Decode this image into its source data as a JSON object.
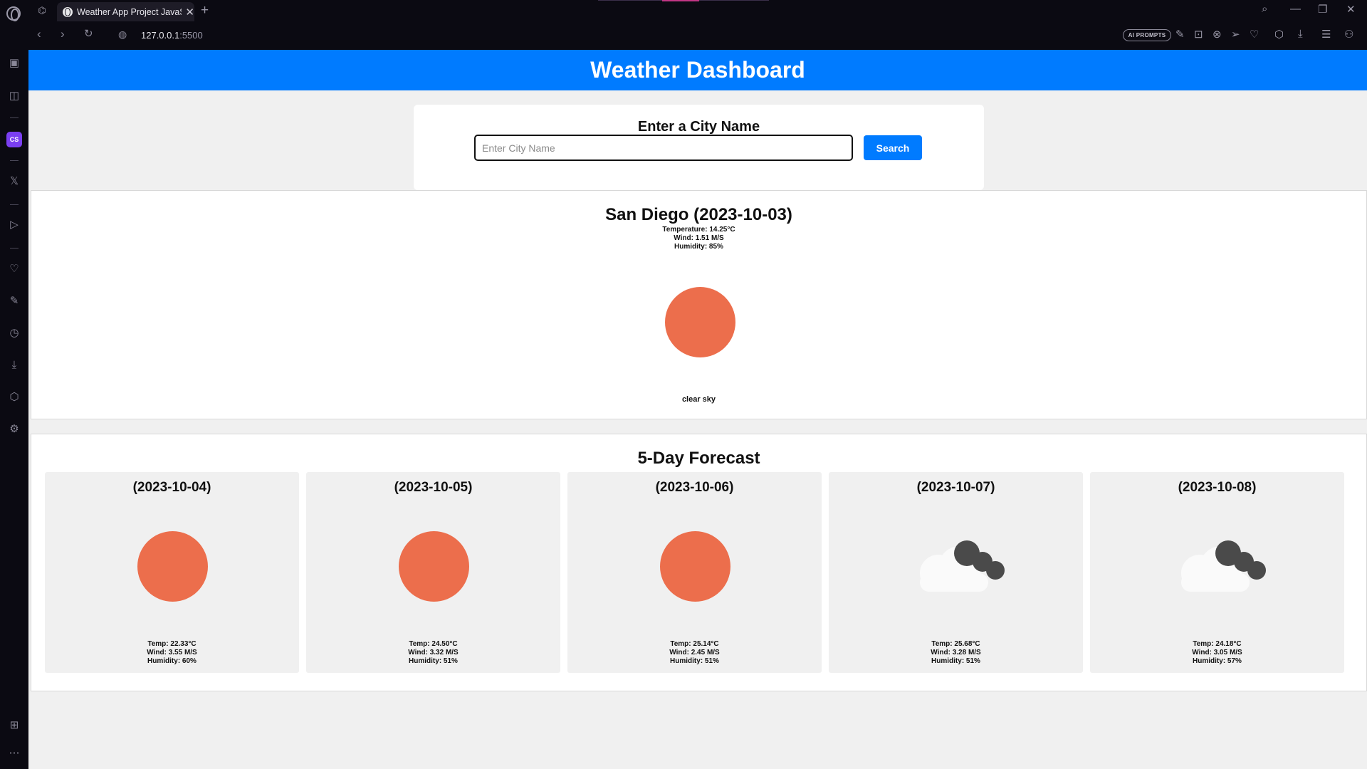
{
  "browser": {
    "tab_title": "Weather App Project JavaScript",
    "tab_close": "✕",
    "new_tab": "+",
    "url_host": "127.0.0.1",
    "url_port": ":5500",
    "ai_prompts_label": "AI PROMPTS",
    "sidebar_cs_label": "CS",
    "sidebar_x_label": "𝕏"
  },
  "page": {
    "header_title": "Weather Dashboard",
    "search": {
      "title": "Enter a City Name",
      "placeholder": "Enter City Name",
      "value": "",
      "button_label": "Search"
    },
    "current": {
      "title": "San Diego (2023-10-03)",
      "temperature": "Temperature: 14.25°C",
      "wind": "Wind: 1.51 M/S",
      "humidity": "Humidity: 85%",
      "description": "clear sky",
      "icon": "sun-icon"
    },
    "forecast": {
      "title": "5-Day Forecast",
      "days": [
        {
          "date": "(2023-10-04)",
          "icon": "sun-icon",
          "temp": "Temp: 22.33°C",
          "wind": "Wind: 3.55 M/S",
          "humidity": "Humidity: 60%"
        },
        {
          "date": "(2023-10-05)",
          "icon": "sun-icon",
          "temp": "Temp: 24.50°C",
          "wind": "Wind: 3.32 M/S",
          "humidity": "Humidity: 51%"
        },
        {
          "date": "(2023-10-06)",
          "icon": "sun-icon",
          "temp": "Temp: 25.14°C",
          "wind": "Wind: 2.45 M/S",
          "humidity": "Humidity: 51%"
        },
        {
          "date": "(2023-10-07)",
          "icon": "cloud-icon",
          "temp": "Temp: 25.68°C",
          "wind": "Wind: 3.28 M/S",
          "humidity": "Humidity: 51%"
        },
        {
          "date": "(2023-10-08)",
          "icon": "cloud-icon",
          "temp": "Temp: 24.18°C",
          "wind": "Wind: 3.05 M/S",
          "humidity": "Humidity: 57%"
        }
      ]
    }
  },
  "colors": {
    "header_blue": "#007bff",
    "sun_orange": "#ec6e4c",
    "page_bg": "#f0f0f0",
    "chrome_bg": "#0b0a12"
  }
}
